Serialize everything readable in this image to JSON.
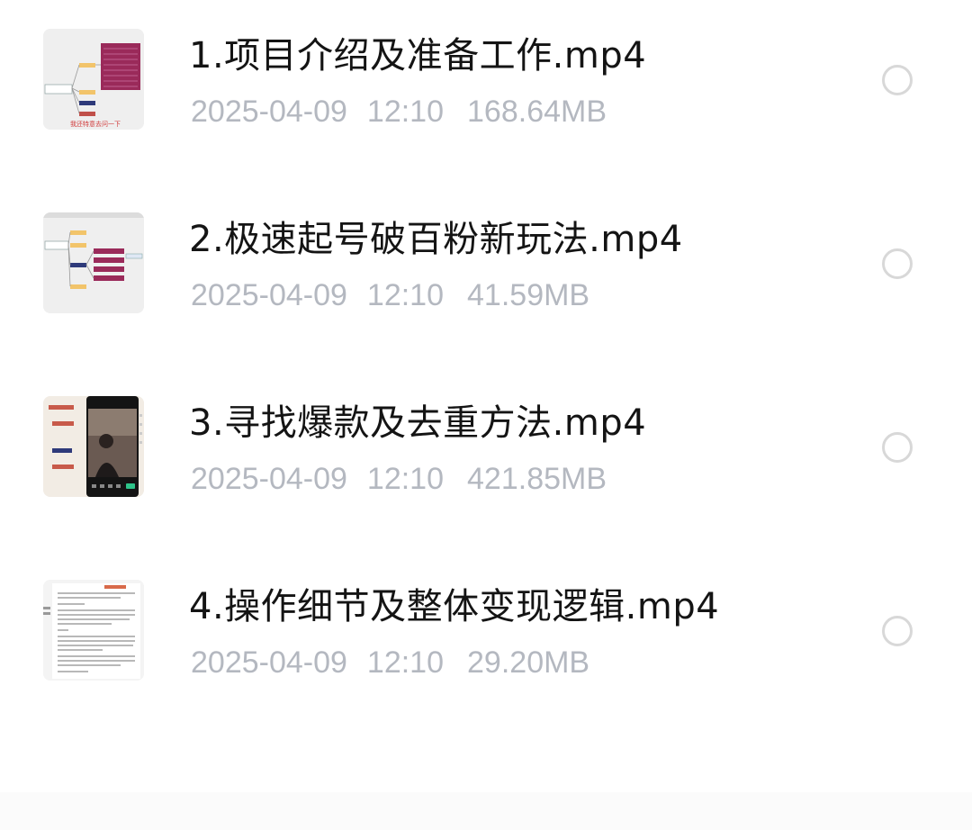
{
  "files": [
    {
      "name": "1.项目介绍及准备工作.mp4",
      "date": "2025-04-09",
      "time": "12:10",
      "size": "168.64MB",
      "thumbnail_icon": "mindmap-thumbnail-icon",
      "thumbnail_caption": "我还特意去问一下"
    },
    {
      "name": "2.极速起号破百粉新玩法.mp4",
      "date": "2025-04-09",
      "time": "12:10",
      "size": "41.59MB",
      "thumbnail_icon": "mindmap-thumbnail-icon"
    },
    {
      "name": "3.寻找爆款及去重方法.mp4",
      "date": "2025-04-09",
      "time": "12:10",
      "size": "421.85MB",
      "thumbnail_icon": "phone-video-thumbnail-icon"
    },
    {
      "name": "4.操作细节及整体变现逻辑.mp4",
      "date": "2025-04-09",
      "time": "12:10",
      "size": "29.20MB",
      "thumbnail_icon": "document-thumbnail-icon"
    }
  ],
  "colors": {
    "title": "#141414",
    "meta": "#b4b8c0",
    "radio_border": "#d8d8d8",
    "mindmap_accent": "#9a2a5a",
    "mindmap_node": "#f2c46a"
  }
}
